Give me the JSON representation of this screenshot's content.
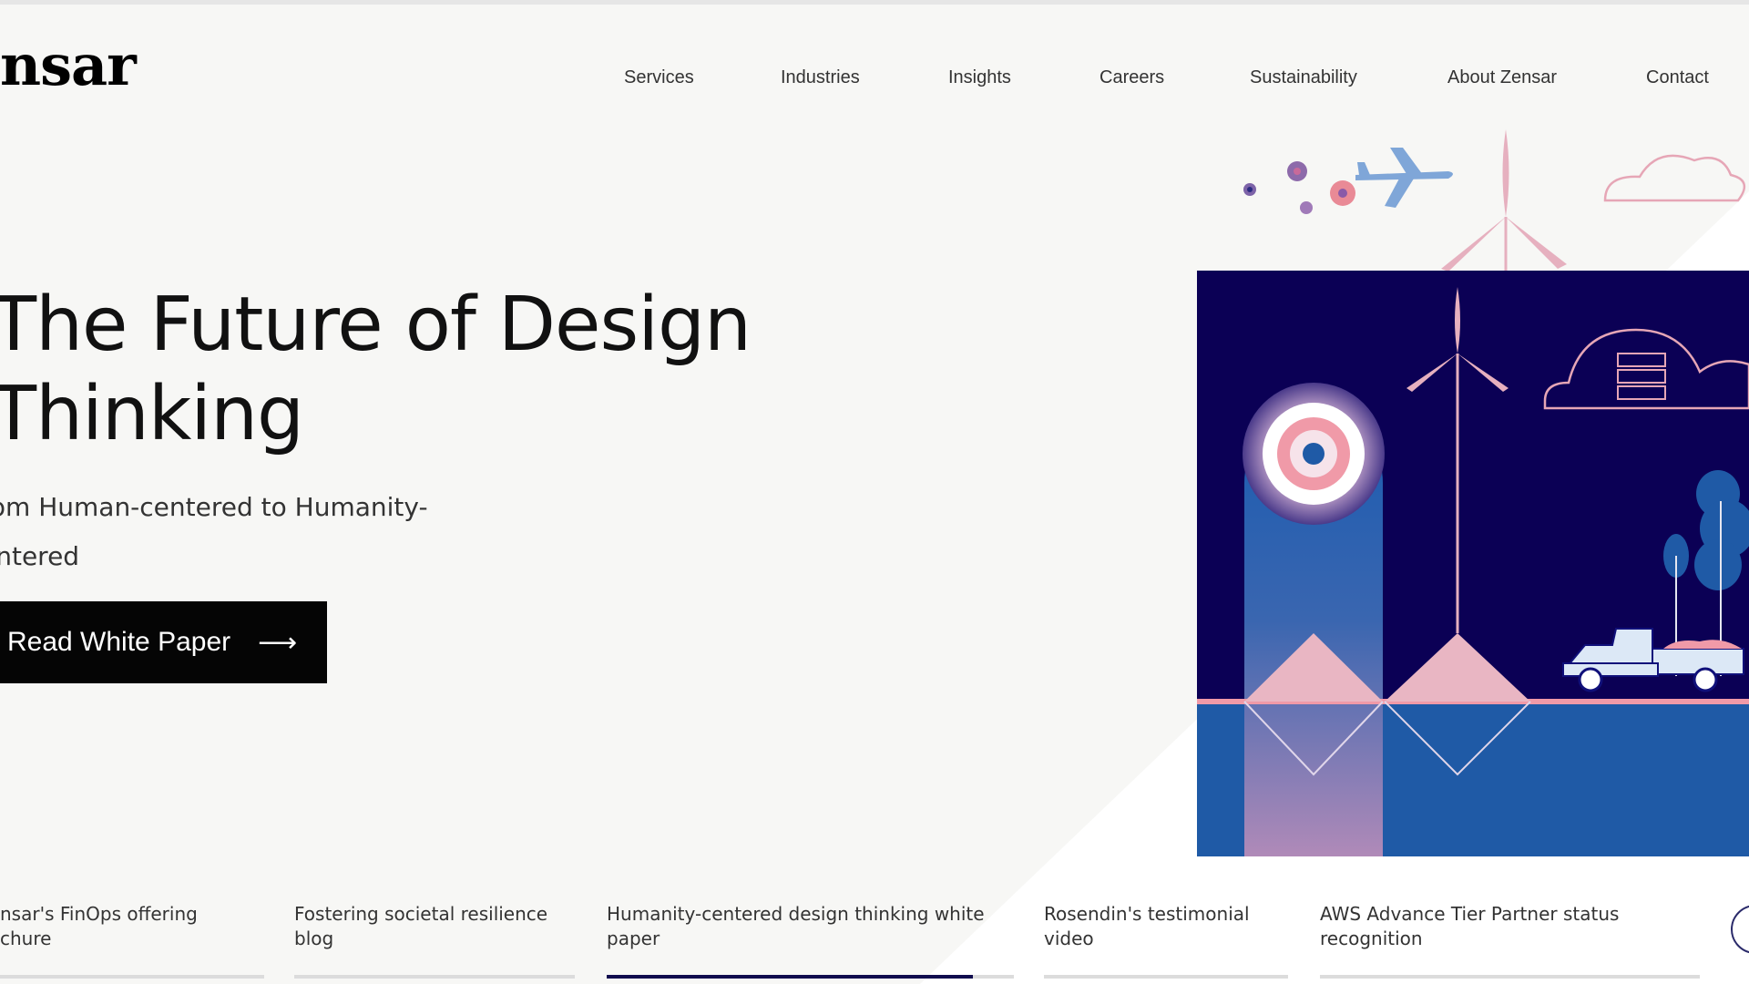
{
  "header": {
    "logo_text": "nsar",
    "nav": [
      {
        "label": "Services"
      },
      {
        "label": "Industries"
      },
      {
        "label": "Insights"
      },
      {
        "label": "Careers"
      },
      {
        "label": "Sustainability"
      },
      {
        "label": "About Zensar"
      },
      {
        "label": "Contact"
      }
    ]
  },
  "hero": {
    "title_line1": "The Future of Design",
    "title_line2": "Thinking",
    "subtitle_line1": "rom Human-centered to Humanity-",
    "subtitle_line2": "entered",
    "cta_label": "Read White Paper",
    "cta_arrow": "⟶"
  },
  "tabs": [
    {
      "label": "nsar's FinOps offering\nchure",
      "progress": 0
    },
    {
      "label": "Fostering societal resilience\nblog",
      "progress": 0
    },
    {
      "label": "Humanity-centered design thinking white\npaper",
      "progress": 0.9
    },
    {
      "label": "Rosendin's testimonial\nvideo",
      "progress": 0
    },
    {
      "label": "AWS Advance Tier Partner status\nrecognition",
      "progress": 0
    }
  ],
  "colors": {
    "navy": "#0b0055",
    "blue": "#1f5aa6",
    "pink": "#e9a7b6",
    "purple": "#7d63a8",
    "cta_bg": "#050505",
    "active_tab": "#100c4e"
  },
  "icons": {
    "cta": "arrow-right-icon",
    "carousel_next": "circle-next-icon"
  }
}
